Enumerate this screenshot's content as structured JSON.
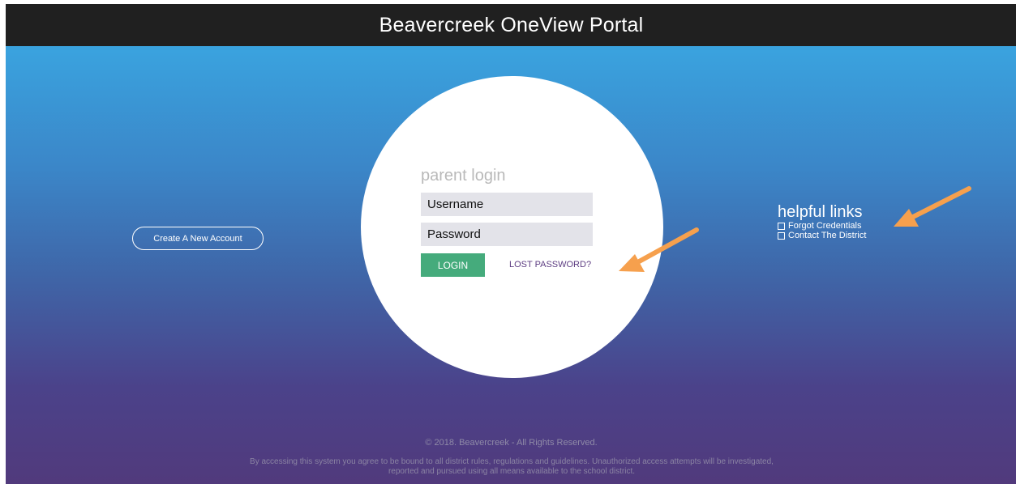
{
  "header": {
    "title": "Beavercreek OneView Portal"
  },
  "left": {
    "create_account_label": "Create A New Account"
  },
  "login": {
    "heading": "parent login",
    "username_label": "Username",
    "password_label": "Password",
    "login_button": "LOGIN",
    "lost_password": "LOST PASSWORD?"
  },
  "helpful_links": {
    "title": "helpful links",
    "items": [
      {
        "label": "Forgot Credentials",
        "icon": "checkbox-square-icon"
      },
      {
        "label": "Contact The District",
        "icon": "checkbox-square-icon"
      }
    ]
  },
  "footer": {
    "copyright": "© 2018. Beavercreek - All Rights Reserved.",
    "disclaimer": "By accessing this system you agree to be bound to all district rules, regulations and guidelines. Unauthorized access attempts will be investigated, reported and pursued using all means available to the school district."
  },
  "colors": {
    "header_bg": "#202020",
    "gradient_top": "#3aa3df",
    "gradient_bottom": "#513a7c",
    "login_button": "#45ab7c",
    "lost_password": "#5d3d82",
    "annotation_arrow": "#f6a04d"
  },
  "annotations": {
    "arrows": [
      "arrow-to-lost-password-icon",
      "arrow-to-helpful-links-icon"
    ]
  }
}
